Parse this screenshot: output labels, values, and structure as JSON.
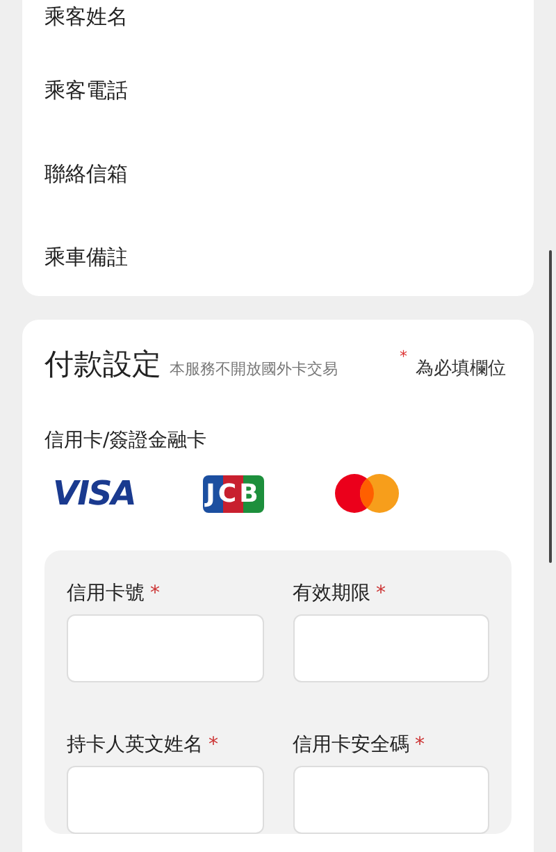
{
  "passenger_fields": [
    {
      "label": "乘客姓名"
    },
    {
      "label": "乘客電話"
    },
    {
      "label": "聯絡信箱"
    },
    {
      "label": "乘車備註"
    }
  ],
  "payment": {
    "title": "付款設定",
    "subtitle": "本服務不開放國外卡交易",
    "required_note": {
      "mark": "*",
      "text": "為必填欄位"
    },
    "card_type_label": "信用卡/簽證金融卡",
    "brands": [
      {
        "kind": "visa",
        "text": "VISA"
      },
      {
        "kind": "jcb",
        "text": "JCB"
      },
      {
        "kind": "mastercard"
      }
    ],
    "fields": [
      {
        "label": "信用卡號",
        "required_mark": "*"
      },
      {
        "label": "有效期限",
        "required_mark": "*"
      },
      {
        "label": "持卡人英文姓名",
        "required_mark": "*"
      },
      {
        "label": "信用卡安全碼",
        "required_mark": "*"
      }
    ]
  }
}
